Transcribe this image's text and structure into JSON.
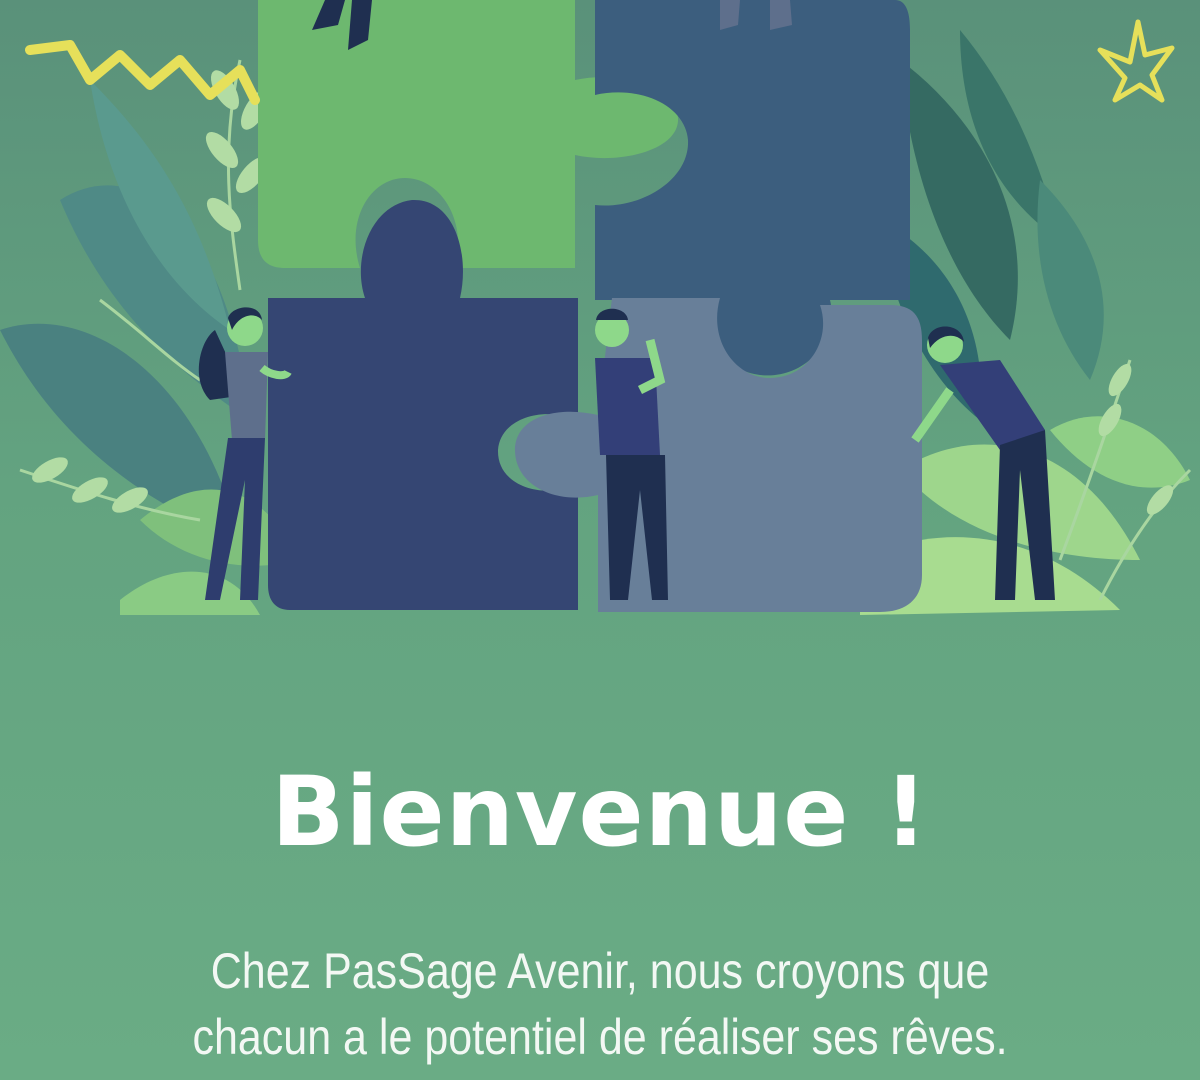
{
  "welcome": {
    "title": "Bienvenue !",
    "intro_line1": "Chez PasSage Avenir, nous croyons que",
    "intro_line2": "chacun a le potentiel de réaliser ses rêves."
  },
  "hero": {
    "illustration": "puzzle-team-illustration",
    "icons": [
      "zigzag-doodle-icon",
      "star-doodle-icon"
    ],
    "colors": {
      "background": "#5f9c7e",
      "light_green": "#6db86f",
      "navy": "#354673",
      "teal_blue": "#3c5e7e",
      "slate": "#687f99",
      "accent_yellow": "#e6e05a"
    }
  }
}
